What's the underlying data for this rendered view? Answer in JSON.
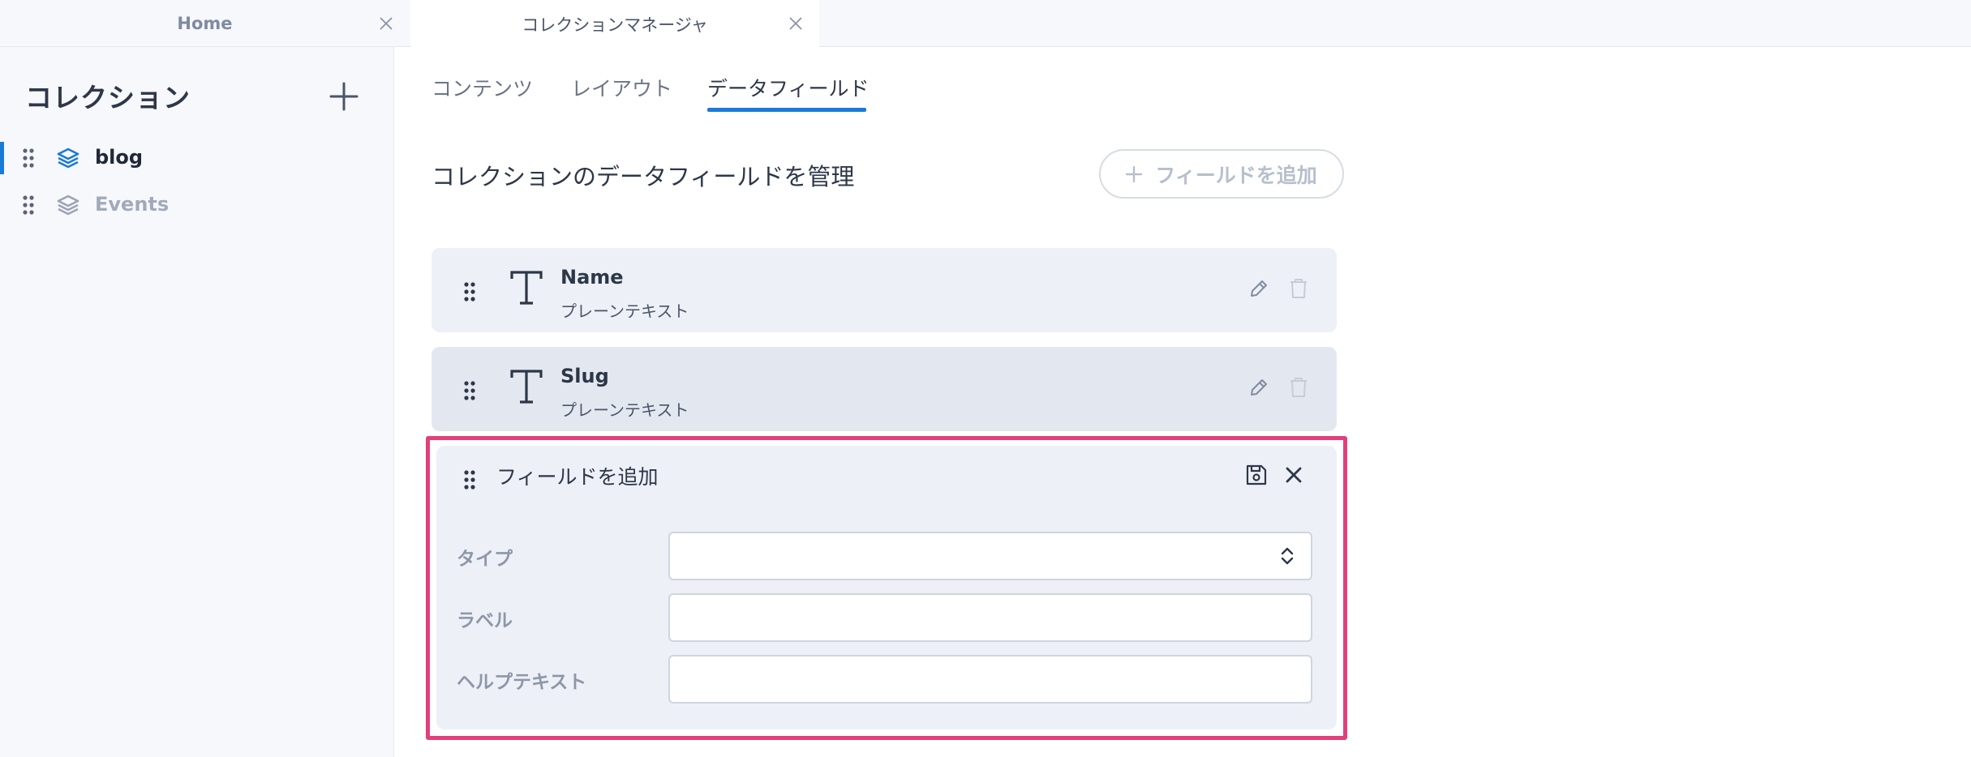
{
  "tabs": [
    {
      "label": "Home"
    },
    {
      "label": "コレクションマネージャ"
    }
  ],
  "sidebar": {
    "title": "コレクション",
    "items": [
      {
        "label": "blog"
      },
      {
        "label": "Events"
      }
    ]
  },
  "content_tabs": [
    {
      "label": "コンテンツ"
    },
    {
      "label": "レイアウト"
    },
    {
      "label": "データフィールド"
    }
  ],
  "section": {
    "title": "コレクションのデータフィールドを管理",
    "add_button_label": "フィールドを追加"
  },
  "fields": [
    {
      "name": "Name",
      "type": "プレーンテキスト"
    },
    {
      "name": "Slug",
      "type": "プレーンテキスト"
    }
  ],
  "new_field": {
    "title": "フィールドを追加",
    "type_label": "タイプ",
    "label_label": "ラベル",
    "help_label": "ヘルプテキスト",
    "type_value": "",
    "label_value": "",
    "help_value": ""
  },
  "colors": {
    "accent": "#1a7ad8",
    "highlight": "#e33f7a"
  }
}
